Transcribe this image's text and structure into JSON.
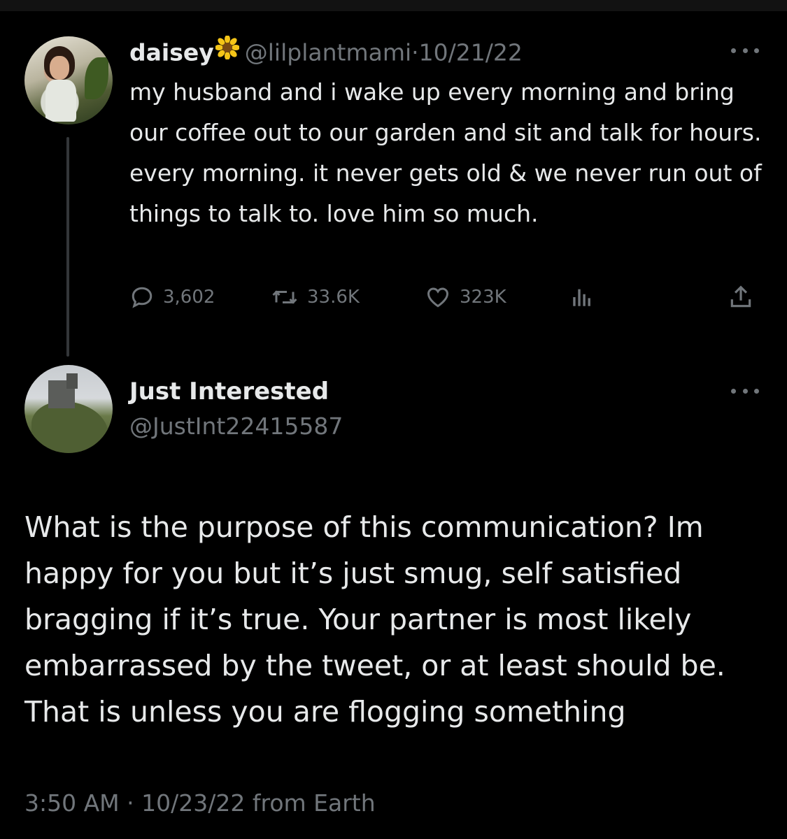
{
  "parent_tweet": {
    "display_name": "daisey",
    "name_emoji": "sunflower-icon",
    "handle": "@lilplantmami",
    "separator": "·",
    "date": "10/21/22",
    "text": "my husband and i wake up every morning and bring our coffee out to our garden and sit and talk for hours. every morning. it never gets old & we never run out of things to talk to. love him so much.",
    "stats": {
      "replies": "3,602",
      "retweets": "33.6K",
      "likes": "323K"
    }
  },
  "reply_tweet": {
    "display_name": "Just Interested",
    "handle": "@JustInt22415587",
    "text": "What is the purpose of this communication? Im happy for you but it’s just smug, self satisfied bragging if it’s true. Your partner is most likely embarrassed by the tweet, or at least should be. That is unless you are flogging something",
    "time": "3:50 AM",
    "separator": "·",
    "date": "10/23/22",
    "source": "from Earth"
  },
  "colors": {
    "background": "#000000",
    "primary_text": "#e7e9ea",
    "secondary_text": "#71767b",
    "thread_line": "#333639"
  }
}
